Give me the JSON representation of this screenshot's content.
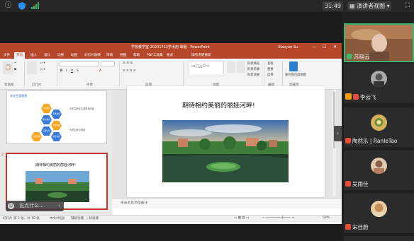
{
  "topbar": {
    "time": "31:49",
    "view_label": "演讲者视图",
    "icons": [
      "info-icon",
      "shield-icon",
      "signal-icon",
      "fullscreen-icon"
    ]
  },
  "ppt": {
    "window_title": "学校教学室 20201712学术用 课题 · PowerPoint",
    "user": "Xiaoyun Su",
    "tabs": [
      "文件",
      "开始",
      "插入",
      "设计",
      "切换",
      "动画",
      "幻灯片放映",
      "审阅",
      "视图",
      "帮助",
      "PDF工具集",
      "格式",
      "操作说明搜索"
    ],
    "ribbon": {
      "groups": [
        "剪贴板",
        "幻灯片",
        "字体",
        "段落",
        "绘图",
        "编辑",
        "加载项"
      ],
      "small_labels": [
        "新建幻灯片",
        "查找",
        "替换",
        "选择",
        "排列",
        "快速样式",
        "形状填充",
        "形状轮廓",
        "形状效果",
        "保存到百度网盘"
      ]
    },
    "thumb1_title": "学业生涯规划",
    "thumb1_hexes": [
      "学业规划",
      "生涯规划",
      "职业规划",
      "专业技能",
      "自我认知",
      "社会实践",
      "综合素质"
    ],
    "thumb1_notes": [
      "大学生职业生涯规划内容",
      "大学生职业规划"
    ],
    "thumb2_num": "2",
    "thumb2_title": "期待相约美丽的丽娃河畔!",
    "slide_title": "期待相约美丽的丽娃河畔!",
    "notes_placeholder": "单击此处添加备注",
    "status": {
      "slide_info": "幻灯片 第 2 张，共 10 张",
      "language": "中文(中国)",
      "accessibility": "辅助功能: 一切就绪",
      "zoom": "58%"
    }
  },
  "chat": {
    "placeholder": "说点什么..."
  },
  "participants": [
    {
      "name": "苏晓云",
      "mic": "on",
      "host": false,
      "active": true
    },
    {
      "name": "李云飞",
      "mic": "off",
      "host": true,
      "active": false
    },
    {
      "name": "陶然乐 | RanleTao",
      "mic": "off",
      "host": false,
      "active": false
    },
    {
      "name": "吴雨佳",
      "mic": "off",
      "host": false,
      "active": false
    },
    {
      "name": "宋佳蔚",
      "mic": "off",
      "host": false,
      "active": false
    }
  ],
  "colors": {
    "ppt_accent": "#b7472a",
    "active_speaker": "#3fb56f",
    "selected_thumb": "#c0392b"
  }
}
